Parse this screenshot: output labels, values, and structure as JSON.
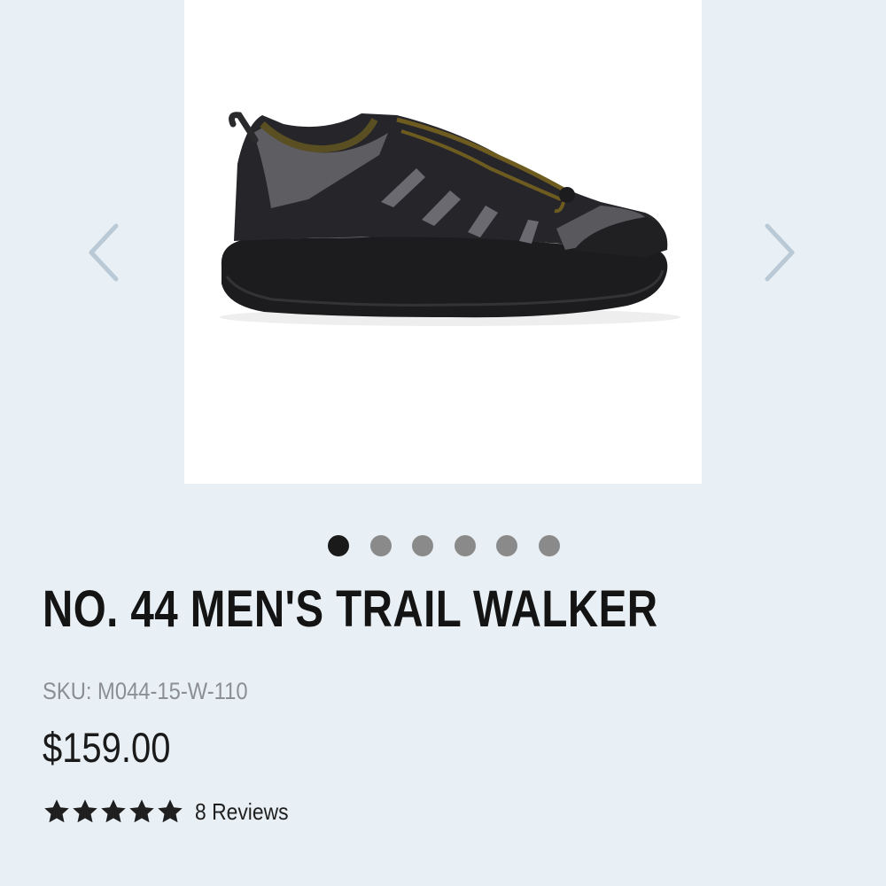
{
  "product": {
    "title": "NO. 44 MEN'S TRAIL WALKER",
    "sku": "SKU: M044-15-W-110",
    "price": "$159.00",
    "rating": {
      "stars": 5,
      "max_stars": 5,
      "reviews_label": "8 Reviews"
    }
  },
  "carousel": {
    "image_alt": "NO. 44 MEN'S TRAIL WALKER",
    "total_slides": 6,
    "active_index": 0,
    "prev_icon": "chevron-left-icon",
    "next_icon": "chevron-right-icon"
  },
  "colors": {
    "background": "#e9f0f5",
    "arrow": "#b9c9d6",
    "dot_active": "#1a1a1a",
    "dot_inactive": "#8a8a8a",
    "star": "#1f1f1f"
  }
}
